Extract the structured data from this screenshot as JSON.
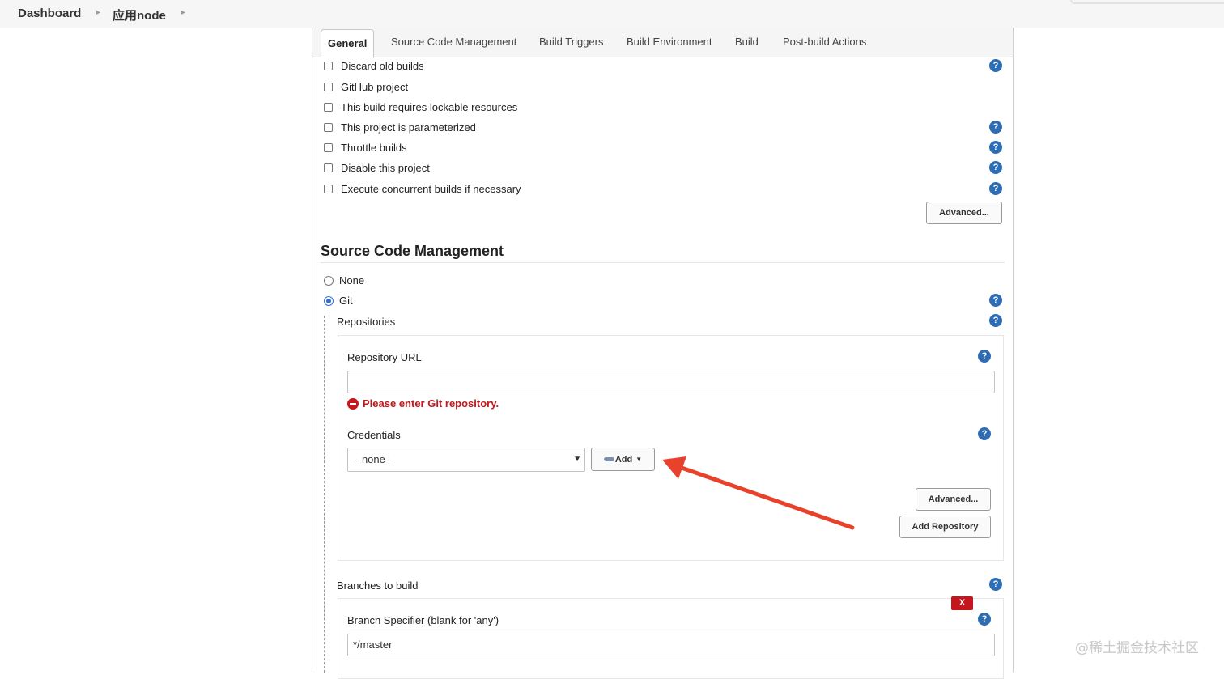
{
  "breadcrumb": {
    "items": [
      "Dashboard",
      "应用node"
    ]
  },
  "tabs": [
    "General",
    "Source Code Management",
    "Build Triggers",
    "Build Environment",
    "Build",
    "Post-build Actions"
  ],
  "general": {
    "options": [
      "Discard old builds",
      "GitHub project",
      "This build requires lockable resources",
      "This project is parameterized",
      "Throttle builds",
      "Disable this project",
      "Execute concurrent builds if necessary"
    ],
    "advanced_label": "Advanced..."
  },
  "scm": {
    "title": "Source Code Management",
    "none_label": "None",
    "git_label": "Git",
    "selected": "Git",
    "repositories_label": "Repositories",
    "repo_url_label": "Repository URL",
    "repo_url_value": "",
    "error_text": "Please enter Git repository.",
    "credentials_label": "Credentials",
    "credentials_selected": "- none -",
    "add_label": "Add",
    "advanced_label": "Advanced...",
    "add_repository_label": "Add Repository",
    "branches_label": "Branches to build",
    "delete_label": "X",
    "branch_specifier_label": "Branch Specifier (blank for 'any')",
    "branch_specifier_value": "*/master"
  },
  "help_glyph": "?",
  "annotation": {
    "arrow_color": "#e8412c"
  },
  "watermark": "@稀土掘金技术社区"
}
